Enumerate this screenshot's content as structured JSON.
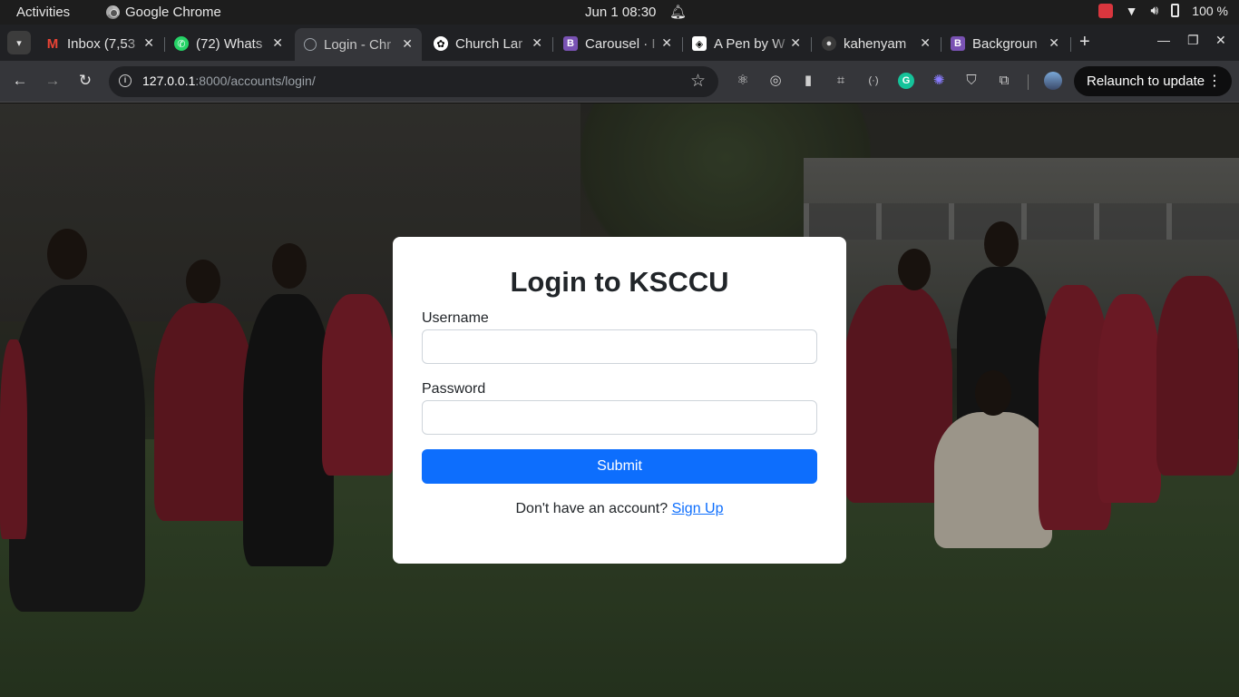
{
  "system_bar": {
    "activities": "Activities",
    "app_name": "Google Chrome",
    "clock": "Jun 1  08:30",
    "battery": "100 %"
  },
  "tabs": [
    {
      "title": "Inbox (7,53",
      "favicon": "gmail-icon",
      "active": false
    },
    {
      "title": "(72) Whats",
      "favicon": "whatsapp-icon",
      "active": false
    },
    {
      "title": "Login - Chr",
      "favicon": "globe-icon",
      "active": true
    },
    {
      "title": "Church Lar",
      "favicon": "openai-icon",
      "active": false
    },
    {
      "title": "Carousel · I",
      "favicon": "bootstrap-icon",
      "active": false
    },
    {
      "title": "A Pen by W",
      "favicon": "codepen-icon",
      "active": false
    },
    {
      "title": "kahenyam",
      "favicon": "github-icon",
      "active": false
    },
    {
      "title": "Backgroun",
      "favicon": "bootstrap-icon",
      "active": false
    }
  ],
  "toolbar": {
    "url_host": "127.0.0.1",
    "url_path": ":8000/accounts/login/",
    "relaunch_label": "Relaunch to update"
  },
  "login": {
    "title": "Login to KSCCU",
    "username_label": "Username",
    "username_value": "",
    "password_label": "Password",
    "password_value": "",
    "submit_label": "Submit",
    "no_account_text": "Don't have an account?",
    "signup_link": "Sign Up"
  },
  "colors": {
    "primary": "#0d6efd",
    "tabstrip": "#202124",
    "toolbar": "#35363a"
  }
}
